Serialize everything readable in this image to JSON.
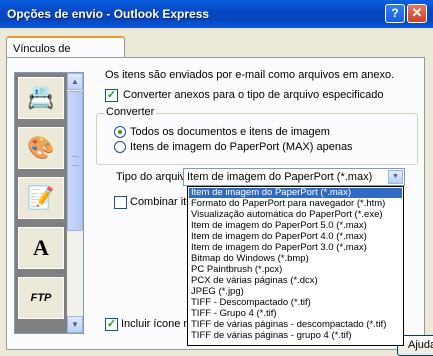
{
  "window": {
    "title": "Opções de envio - Outlook Express",
    "help_glyph": "?",
    "close_glyph": "✕"
  },
  "tab": {
    "label": "Vínculos de programas"
  },
  "programs": [
    {
      "icon": "📇",
      "selected": true
    },
    {
      "icon": "🎨",
      "selected": false
    },
    {
      "icon": "📝",
      "selected": false
    },
    {
      "icon": "A",
      "selected": false
    },
    {
      "icon": "FTP",
      "selected": false
    }
  ],
  "content": {
    "intro": "Os itens são enviados por e-mail como arquivos em anexo.",
    "convert_checkbox": "Converter anexos para o tipo de arquivo especificado",
    "converter_group": "Converter",
    "radio_all": "Todos os documentos e itens de imagem",
    "radio_max": "Itens de imagem do PaperPort (MAX) apenas",
    "filetype_label": "Tipo do arquivo:",
    "filetype_value": "Item de imagem do PaperPort (*.max)",
    "combine_label": "Combinar itens",
    "include_label": "Incluir ícone na"
  },
  "dropdown_options": [
    "Item de imagem do PaperPort (*.max)",
    "Formato do PaperPort para navegador (*.htm)",
    "Visualização automática do PaperPort (*.exe)",
    "Item de imagem do PaperPort 5.0 (*.max)",
    "Item de imagem do PaperPort 4.0 (*.max)",
    "Item de imagem do PaperPort 3.0 (*.max)",
    "Bitmap do Windows (*.bmp)",
    "PC Paintbrush (*.pcx)",
    "PCX de várias páginas (*.dcx)",
    "JPEG (*.jpg)",
    "TIFF - Descompactado (*.tif)",
    "TIFF - Grupo 4 (*.tif)",
    "TIFF de várias páginas - descompactado (*.tif)",
    "TIFF de várias páginas - grupo 4 (*.tif)"
  ],
  "buttons": {
    "help": "Ajuda"
  }
}
